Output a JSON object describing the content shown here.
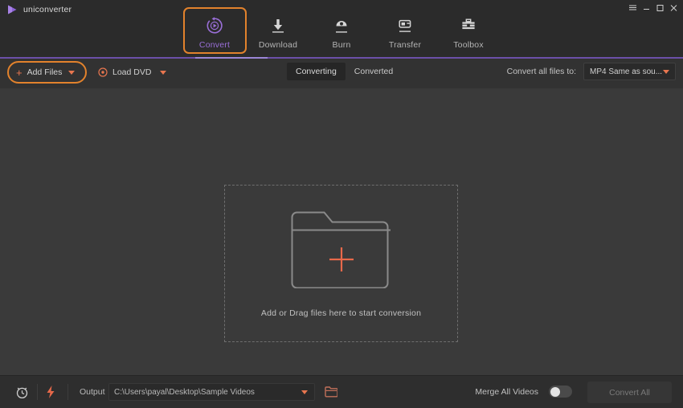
{
  "window": {
    "app_name": "uniconverter",
    "logo_icon": "play-triangle-logo",
    "controls": [
      {
        "name": "menu",
        "icon": "hamburger-menu-icon",
        "glyph": "≡"
      },
      {
        "name": "minimize",
        "icon": "minimize-icon",
        "glyph": "–"
      },
      {
        "name": "maximize",
        "icon": "maximize-icon",
        "glyph": "□"
      },
      {
        "name": "close",
        "icon": "close-icon",
        "glyph": "✕"
      }
    ]
  },
  "nav": {
    "active_index": 0,
    "tabs": [
      {
        "label": "Convert",
        "icon": "convert-circular-play-icon"
      },
      {
        "label": "Download",
        "icon": "download-arrow-icon"
      },
      {
        "label": "Burn",
        "icon": "burn-disc-icon"
      },
      {
        "label": "Transfer",
        "icon": "transfer-device-icon"
      },
      {
        "label": "Toolbox",
        "icon": "toolbox-icon"
      }
    ]
  },
  "actionbar": {
    "add_files": {
      "label": "Add Files",
      "plus_glyph": "+",
      "icon": "plus-icon",
      "caret_icon": "caret-down-icon"
    },
    "load_dvd": {
      "label": "Load DVD",
      "icon": "disc-icon",
      "caret_icon": "caret-down-icon"
    },
    "segmented_tabs": [
      {
        "label": "Converting",
        "active": true
      },
      {
        "label": "Converted",
        "active": false
      }
    ],
    "convert_all_to": {
      "label": "Convert all files to:",
      "value": "MP4 Same as sou...",
      "caret_icon": "caret-down-icon"
    }
  },
  "main": {
    "dropzone": {
      "icon": "folder-plus-icon",
      "plus_glyph": "+",
      "text": "Add or Drag files here to start conversion"
    }
  },
  "bottombar": {
    "timer_icon": "alarm-clock-icon",
    "speed_icon": "lightning-bolt-icon",
    "output_label": "Output",
    "output_path": "C:\\Users\\payal\\Desktop\\Sample Videos",
    "output_caret_icon": "caret-down-icon",
    "browse_icon": "folder-open-icon",
    "merge_label": "Merge All Videos",
    "merge_enabled": false,
    "convert_all_label": "Convert All"
  },
  "colors": {
    "window_bg": "#2b2b2b",
    "content_bg": "#3a3a3a",
    "actionbar_bg": "#323232",
    "bottombar_bg": "#2e2e2e",
    "accent_purple": "#9a6fd8",
    "divider_purple": "#6b4fa8",
    "accent_orange": "#e2822c",
    "accent_salmon": "#e8764f",
    "text_primary": "#d3d3d3",
    "text_muted": "#b4b4b4",
    "disabled_text": "#7a7a7a"
  }
}
